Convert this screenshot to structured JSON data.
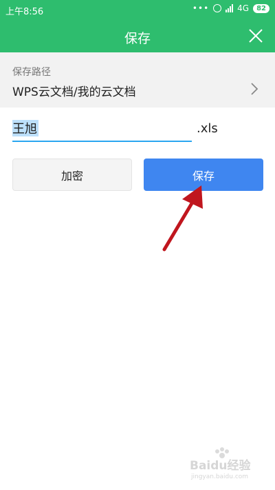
{
  "status_bar": {
    "time": "上午8:56",
    "network": "4G",
    "battery": "82"
  },
  "header": {
    "title": "保存"
  },
  "path": {
    "label": "保存路径",
    "value": "WPS云文档/我的云文档"
  },
  "filename": {
    "value": "王旭",
    "extension": ".xls"
  },
  "buttons": {
    "encrypt_label": "加密",
    "save_label": "保存"
  },
  "watermark": {
    "text": "Baidu经验",
    "subtext": "jingyan.baidu.com"
  },
  "colors": {
    "header_green": "#2ebd6e",
    "save_blue": "#3f86f0",
    "input_underline": "#29a6f0",
    "annotation_red": "#c0161e"
  }
}
